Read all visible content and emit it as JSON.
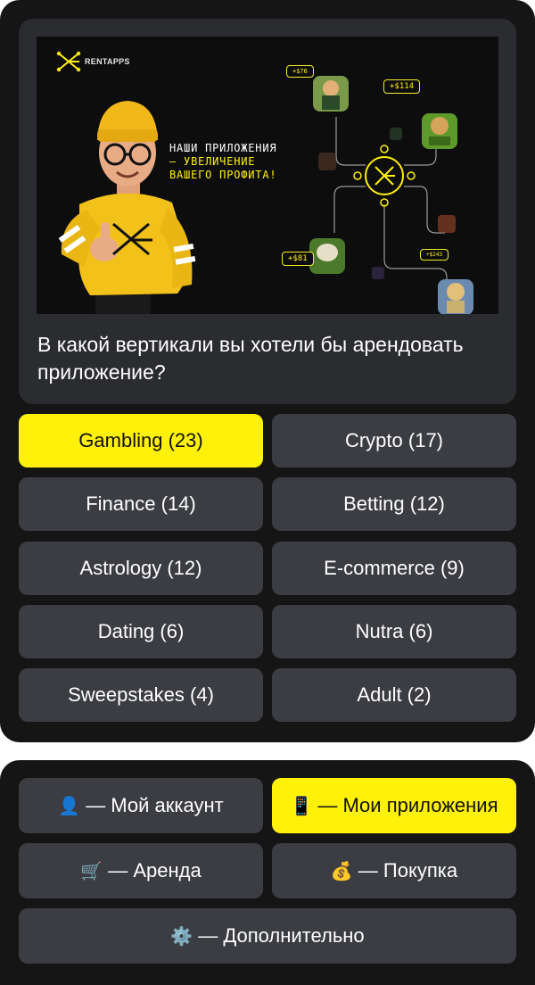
{
  "banner": {
    "logo_text": "RENTAPPS",
    "tagline": [
      "НАШИ ПРИЛОЖЕНИЯ",
      "— УВЕЛИЧЕНИЕ",
      "ВАШЕГО ПРОФИТА!"
    ],
    "profit_tags": [
      "+$76",
      "+$114",
      "+$81",
      "+$243"
    ]
  },
  "message": {
    "text": "В какой вертикали вы хотели бы арендовать приложение?"
  },
  "verticals": [
    {
      "label": "Gambling (23)",
      "selected": true
    },
    {
      "label": "Crypto (17)",
      "selected": false
    },
    {
      "label": "Finance (14)",
      "selected": false
    },
    {
      "label": "Betting (12)",
      "selected": false
    },
    {
      "label": "Astrology (12)",
      "selected": false
    },
    {
      "label": "E-commerce (9)",
      "selected": false
    },
    {
      "label": "Dating (6)",
      "selected": false
    },
    {
      "label": "Nutra (6)",
      "selected": false
    },
    {
      "label": "Sweepstakes (4)",
      "selected": false
    },
    {
      "label": "Adult (2)",
      "selected": false
    }
  ],
  "menu": {
    "account": {
      "icon": "👤",
      "label": "— Мой аккаунт"
    },
    "my_apps": {
      "icon": "📱",
      "label": "— Мои приложения",
      "selected": true
    },
    "rent": {
      "icon": "🛒",
      "label": "— Аренда"
    },
    "purchase": {
      "icon": "💰",
      "label": "— Покупка"
    },
    "more": {
      "icon": "⚙️",
      "label": "— Дополнительно"
    }
  },
  "colors": {
    "accent": "#fff10a",
    "panel": "#151515",
    "bubble": "#2b2c30",
    "button": "#3b3d43"
  }
}
